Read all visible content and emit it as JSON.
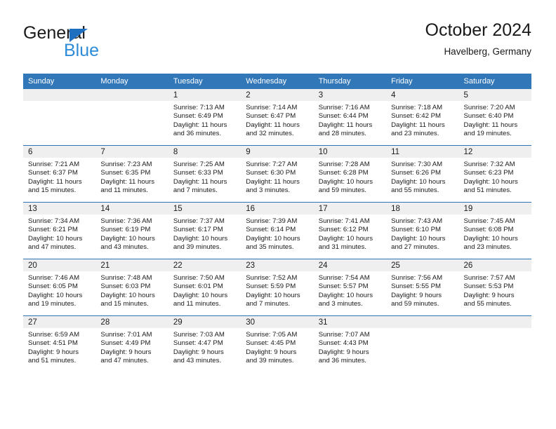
{
  "brand": {
    "name_dark": "General",
    "name_blue": "Blue",
    "triangle_color": "#1F6FC0",
    "blue_text_color": "#2E8BD8"
  },
  "header": {
    "title": "October 2024",
    "subtitle": "Havelberg, Germany"
  },
  "theme": {
    "header_blue": "#3277B8",
    "row_separator_blue": "#2E74B5",
    "date_band_gray": "#EFEFEF",
    "text_color": "#1A1A1A"
  },
  "weekday_headers": [
    "Sunday",
    "Monday",
    "Tuesday",
    "Wednesday",
    "Thursday",
    "Friday",
    "Saturday"
  ],
  "weeks": [
    [
      {
        "day": "",
        "sunrise": "",
        "sunset": "",
        "daylight": "",
        "empty": true
      },
      {
        "day": "",
        "sunrise": "",
        "sunset": "",
        "daylight": "",
        "empty": true
      },
      {
        "day": "1",
        "sunrise": "Sunrise: 7:13 AM",
        "sunset": "Sunset: 6:49 PM",
        "daylight": "Daylight: 11 hours and 36 minutes."
      },
      {
        "day": "2",
        "sunrise": "Sunrise: 7:14 AM",
        "sunset": "Sunset: 6:47 PM",
        "daylight": "Daylight: 11 hours and 32 minutes."
      },
      {
        "day": "3",
        "sunrise": "Sunrise: 7:16 AM",
        "sunset": "Sunset: 6:44 PM",
        "daylight": "Daylight: 11 hours and 28 minutes."
      },
      {
        "day": "4",
        "sunrise": "Sunrise: 7:18 AM",
        "sunset": "Sunset: 6:42 PM",
        "daylight": "Daylight: 11 hours and 23 minutes."
      },
      {
        "day": "5",
        "sunrise": "Sunrise: 7:20 AM",
        "sunset": "Sunset: 6:40 PM",
        "daylight": "Daylight: 11 hours and 19 minutes."
      }
    ],
    [
      {
        "day": "6",
        "sunrise": "Sunrise: 7:21 AM",
        "sunset": "Sunset: 6:37 PM",
        "daylight": "Daylight: 11 hours and 15 minutes."
      },
      {
        "day": "7",
        "sunrise": "Sunrise: 7:23 AM",
        "sunset": "Sunset: 6:35 PM",
        "daylight": "Daylight: 11 hours and 11 minutes."
      },
      {
        "day": "8",
        "sunrise": "Sunrise: 7:25 AM",
        "sunset": "Sunset: 6:33 PM",
        "daylight": "Daylight: 11 hours and 7 minutes."
      },
      {
        "day": "9",
        "sunrise": "Sunrise: 7:27 AM",
        "sunset": "Sunset: 6:30 PM",
        "daylight": "Daylight: 11 hours and 3 minutes."
      },
      {
        "day": "10",
        "sunrise": "Sunrise: 7:28 AM",
        "sunset": "Sunset: 6:28 PM",
        "daylight": "Daylight: 10 hours and 59 minutes."
      },
      {
        "day": "11",
        "sunrise": "Sunrise: 7:30 AM",
        "sunset": "Sunset: 6:26 PM",
        "daylight": "Daylight: 10 hours and 55 minutes."
      },
      {
        "day": "12",
        "sunrise": "Sunrise: 7:32 AM",
        "sunset": "Sunset: 6:23 PM",
        "daylight": "Daylight: 10 hours and 51 minutes."
      }
    ],
    [
      {
        "day": "13",
        "sunrise": "Sunrise: 7:34 AM",
        "sunset": "Sunset: 6:21 PM",
        "daylight": "Daylight: 10 hours and 47 minutes."
      },
      {
        "day": "14",
        "sunrise": "Sunrise: 7:36 AM",
        "sunset": "Sunset: 6:19 PM",
        "daylight": "Daylight: 10 hours and 43 minutes."
      },
      {
        "day": "15",
        "sunrise": "Sunrise: 7:37 AM",
        "sunset": "Sunset: 6:17 PM",
        "daylight": "Daylight: 10 hours and 39 minutes."
      },
      {
        "day": "16",
        "sunrise": "Sunrise: 7:39 AM",
        "sunset": "Sunset: 6:14 PM",
        "daylight": "Daylight: 10 hours and 35 minutes."
      },
      {
        "day": "17",
        "sunrise": "Sunrise: 7:41 AM",
        "sunset": "Sunset: 6:12 PM",
        "daylight": "Daylight: 10 hours and 31 minutes."
      },
      {
        "day": "18",
        "sunrise": "Sunrise: 7:43 AM",
        "sunset": "Sunset: 6:10 PM",
        "daylight": "Daylight: 10 hours and 27 minutes."
      },
      {
        "day": "19",
        "sunrise": "Sunrise: 7:45 AM",
        "sunset": "Sunset: 6:08 PM",
        "daylight": "Daylight: 10 hours and 23 minutes."
      }
    ],
    [
      {
        "day": "20",
        "sunrise": "Sunrise: 7:46 AM",
        "sunset": "Sunset: 6:05 PM",
        "daylight": "Daylight: 10 hours and 19 minutes."
      },
      {
        "day": "21",
        "sunrise": "Sunrise: 7:48 AM",
        "sunset": "Sunset: 6:03 PM",
        "daylight": "Daylight: 10 hours and 15 minutes."
      },
      {
        "day": "22",
        "sunrise": "Sunrise: 7:50 AM",
        "sunset": "Sunset: 6:01 PM",
        "daylight": "Daylight: 10 hours and 11 minutes."
      },
      {
        "day": "23",
        "sunrise": "Sunrise: 7:52 AM",
        "sunset": "Sunset: 5:59 PM",
        "daylight": "Daylight: 10 hours and 7 minutes."
      },
      {
        "day": "24",
        "sunrise": "Sunrise: 7:54 AM",
        "sunset": "Sunset: 5:57 PM",
        "daylight": "Daylight: 10 hours and 3 minutes."
      },
      {
        "day": "25",
        "sunrise": "Sunrise: 7:56 AM",
        "sunset": "Sunset: 5:55 PM",
        "daylight": "Daylight: 9 hours and 59 minutes."
      },
      {
        "day": "26",
        "sunrise": "Sunrise: 7:57 AM",
        "sunset": "Sunset: 5:53 PM",
        "daylight": "Daylight: 9 hours and 55 minutes."
      }
    ],
    [
      {
        "day": "27",
        "sunrise": "Sunrise: 6:59 AM",
        "sunset": "Sunset: 4:51 PM",
        "daylight": "Daylight: 9 hours and 51 minutes."
      },
      {
        "day": "28",
        "sunrise": "Sunrise: 7:01 AM",
        "sunset": "Sunset: 4:49 PM",
        "daylight": "Daylight: 9 hours and 47 minutes."
      },
      {
        "day": "29",
        "sunrise": "Sunrise: 7:03 AM",
        "sunset": "Sunset: 4:47 PM",
        "daylight": "Daylight: 9 hours and 43 minutes."
      },
      {
        "day": "30",
        "sunrise": "Sunrise: 7:05 AM",
        "sunset": "Sunset: 4:45 PM",
        "daylight": "Daylight: 9 hours and 39 minutes."
      },
      {
        "day": "31",
        "sunrise": "Sunrise: 7:07 AM",
        "sunset": "Sunset: 4:43 PM",
        "daylight": "Daylight: 9 hours and 36 minutes."
      },
      {
        "day": "",
        "sunrise": "",
        "sunset": "",
        "daylight": "",
        "empty": true
      },
      {
        "day": "",
        "sunrise": "",
        "sunset": "",
        "daylight": "",
        "empty": true
      }
    ]
  ]
}
